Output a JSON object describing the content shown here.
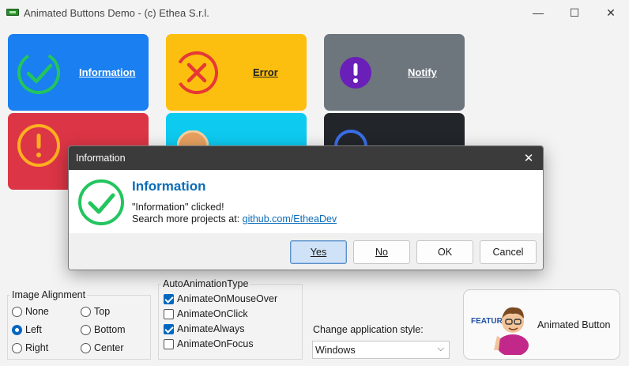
{
  "window": {
    "title": "Animated Buttons Demo - (c) Ethea S.r.l.",
    "controls": {
      "minimize": "—",
      "maximize": "☐",
      "close": "✕"
    }
  },
  "tiles": {
    "information": {
      "label": "Information",
      "color": "#1a7ff0",
      "icon": "check-circle-icon"
    },
    "error": {
      "label": "Error",
      "color": "#fdbf0f",
      "icon": "x-circle-icon"
    },
    "notify": {
      "label": "Notify",
      "color": "#6d757d",
      "icon": "exclamation-filled-icon"
    },
    "warning": {
      "color": "#dc3545",
      "icon": "exclamation-circle-icon"
    },
    "cyan": {
      "color": "#0dcaf0",
      "icon": "partial-icon"
    },
    "dark": {
      "color": "#22262b",
      "icon": "partial-icon"
    }
  },
  "image_alignment": {
    "title": "Image Alignment",
    "options": [
      "None",
      "Top",
      "Left",
      "Bottom",
      "Right",
      "Center"
    ],
    "selected": "Left"
  },
  "auto_animation": {
    "title": "AutoAnimationType",
    "options": [
      {
        "label": "AnimateOnMouseOver",
        "checked": true
      },
      {
        "label": "AnimateOnClick",
        "checked": false
      },
      {
        "label": "AnimateAlways",
        "checked": true
      },
      {
        "label": "AnimateOnFocus",
        "checked": false
      }
    ]
  },
  "style": {
    "label": "Change application style:",
    "value": "Windows"
  },
  "feature_button": {
    "badge": "FEATURE",
    "label": "Animated Button"
  },
  "dialog": {
    "title": "Information",
    "close": "✕",
    "heading": "Information",
    "message": "\"Information\" clicked!",
    "search_prefix": "Search more projects at: ",
    "link": "github.com/EtheaDev",
    "buttons": {
      "yes": "Yes",
      "no": "No",
      "ok": "OK",
      "cancel": "Cancel"
    }
  }
}
